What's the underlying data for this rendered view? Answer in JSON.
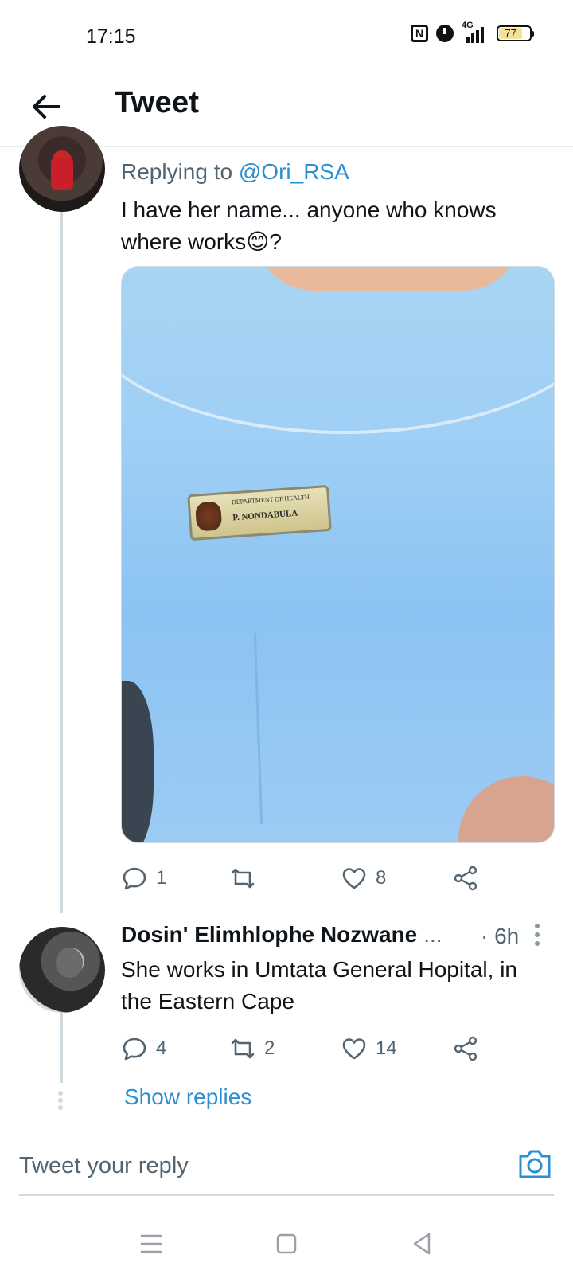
{
  "status_bar": {
    "time": "17:15",
    "network": "4G",
    "battery": "77",
    "icons": [
      "nfc-icon",
      "alarm-icon",
      "signal-icon",
      "battery-icon"
    ]
  },
  "header": {
    "title": "Tweet",
    "back_icon": "arrow-left-icon"
  },
  "tweet1": {
    "replying_prefix": "Replying to",
    "replying_handle": "@Ori_RSA",
    "text_line1": "I have her name... anyone who knows",
    "text_line2": "where works",
    "emoji": "😊",
    "text_end": "?",
    "media": {
      "badge_line1": "DEPARTMENT OF HEALTH",
      "badge_line2": "P. NONDABULA"
    },
    "actions": {
      "replies": "1",
      "retweets": "",
      "likes": "8"
    }
  },
  "tweet2": {
    "author": "Dosin' Elimhlophe Nozwane",
    "author_ellipsis": "...",
    "timestamp": "· 6h",
    "text_line1": "She works in Umtata General Hopital,  in",
    "text_line2": "the Eastern Cape",
    "actions": {
      "replies": "4",
      "retweets": "2",
      "likes": "14"
    }
  },
  "show_replies": "Show replies",
  "reply_box": {
    "placeholder": "Tweet your reply",
    "camera_icon": "camera-icon"
  },
  "colors": {
    "link": "#2b8fd3",
    "secondary_text": "#536471",
    "thread_line": "#cfd9de"
  }
}
